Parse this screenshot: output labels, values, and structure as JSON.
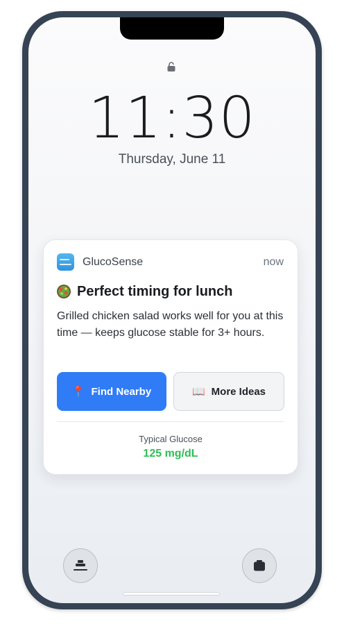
{
  "lockscreen": {
    "time": "11:30",
    "date": "Thursday, June 11"
  },
  "notification": {
    "app_name": "GlucoSense",
    "timestamp": "now",
    "title_icon": "salad-icon",
    "title": "Perfect timing for lunch",
    "body": "Grilled chicken salad works well for you at this time — keeps glucose stable for 3+ hours.",
    "primary_button": {
      "icon": "📍",
      "label": "Find Nearby"
    },
    "secondary_button": {
      "icon": "📖",
      "label": "More Ideas"
    },
    "glucose": {
      "label": "Typical Glucose",
      "value": "125 mg/dL"
    }
  },
  "colors": {
    "accent_blue": "#2f7cf6",
    "glucose_green": "#2fbd55",
    "frame": "#364354"
  },
  "quick_actions": {
    "left": "bed-icon",
    "right": "camera-icon"
  }
}
